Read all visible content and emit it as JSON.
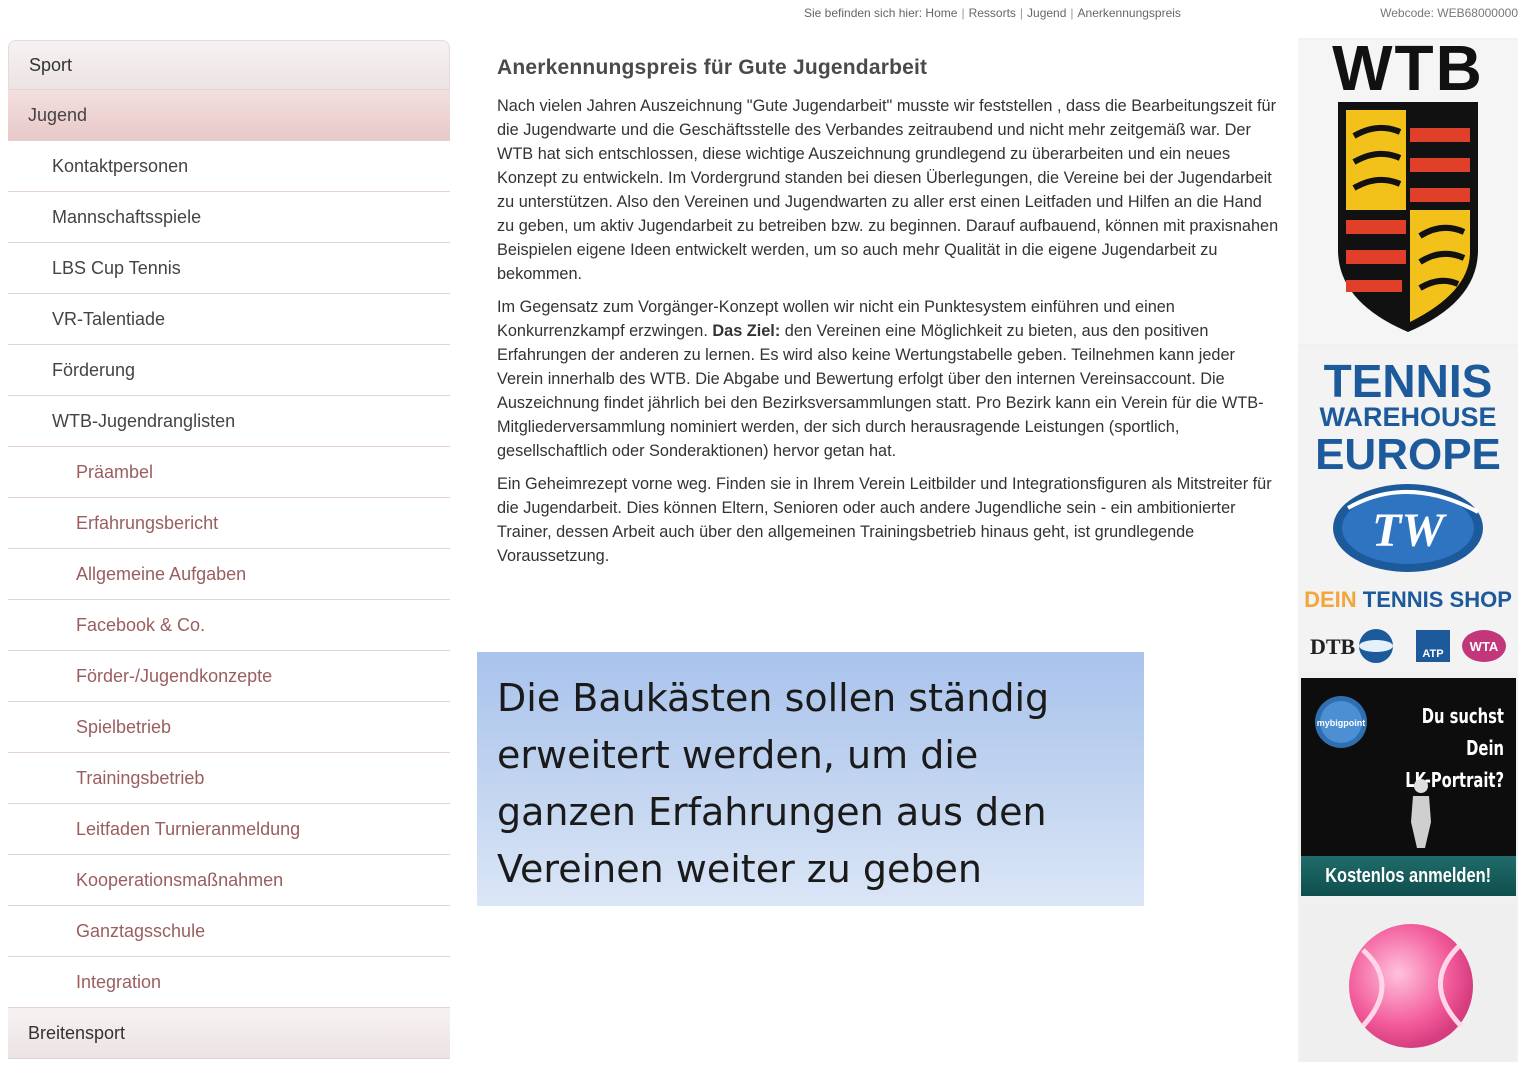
{
  "breadcrumb": {
    "prefix": "Sie befinden sich hier:",
    "items": [
      "Home",
      "Ressorts",
      "Jugend",
      "Anerkennungspreis"
    ]
  },
  "webcode": "Webcode: WEB68000000",
  "sidebar": {
    "items": [
      {
        "label": "Sport",
        "level": 0
      },
      {
        "label": "Jugend",
        "level": 0,
        "active": true
      },
      {
        "label": "Kontaktpersonen",
        "level": 1
      },
      {
        "label": "Mannschaftsspiele",
        "level": 1
      },
      {
        "label": "LBS Cup Tennis",
        "level": 1
      },
      {
        "label": "VR-Talentiade",
        "level": 1
      },
      {
        "label": "Förderung",
        "level": 1
      },
      {
        "label": "WTB-Jugendranglisten",
        "level": 1
      },
      {
        "label": "Präambel",
        "level": 2
      },
      {
        "label": "Erfahrungsbericht",
        "level": 2
      },
      {
        "label": "Allgemeine Aufgaben",
        "level": 2
      },
      {
        "label": "Facebook & Co.",
        "level": 2
      },
      {
        "label": "Förder-/Jugendkonzepte",
        "level": 2
      },
      {
        "label": "Spielbetrieb",
        "level": 2
      },
      {
        "label": "Trainingsbetrieb",
        "level": 2
      },
      {
        "label": "Leitfaden Turnieranmeldung",
        "level": 2
      },
      {
        "label": "Kooperationsmaßnahmen",
        "level": 2
      },
      {
        "label": "Ganztagsschule",
        "level": 2
      },
      {
        "label": "Integration",
        "level": 2
      },
      {
        "label": "Breitensport",
        "level": 0
      }
    ]
  },
  "article": {
    "title": "Anerkennungspreis für Gute Jugendarbeit",
    "p1": "Nach vielen Jahren Auszeichnung \"Gute Jugendarbeit\" musste wir feststellen , dass die Bearbeitungszeit für die Jugendwarte und die Geschäftsstelle des Verbandes zeitraubend und nicht mehr zeitgemäß war. Der WTB hat sich entschlossen, diese wichtige Auszeichnung grundlegend zu überarbeiten und ein neues Konzept zu entwickeln. Im Vordergrund standen bei diesen Überlegungen, die Vereine bei der Jugendarbeit zu unterstützen. Also den Vereinen und Jugendwarten zu aller erst einen Leitfaden und Hilfen an die Hand zu geben, um aktiv Jugendarbeit zu betreiben bzw. zu beginnen. Darauf aufbauend, können mit praxisnahen Beispielen eigene Ideen entwickelt werden, um so auch mehr Qualität in die eigene Jugendarbeit zu bekommen.",
    "p2_pre": "Im Gegensatz zum Vorgänger-Konzept wollen wir nicht ein Punktesystem einführen und einen Konkurrenzkampf erzwingen.",
    "p2_bold": "Das Ziel:",
    "p2_post": "den Vereinen eine Möglichkeit zu bieten, aus den positiven Erfahrungen der anderen zu lernen. Es wird also keine Wertungstabelle geben. Teilnehmen kann jeder Verein innerhalb des WTB. Die Abgabe und Bewertung erfolgt über den internen Vereinsaccount. Die Auszeichnung findet jährlich bei den Bezirksversammlungen statt. Pro Bezirk kann ein Verein für die WTB-Mitgliederversammlung nominiert werden, der sich durch herausragende Leistungen (sportlich, gesellschaftlich oder Sonderaktionen) hervor getan hat.",
    "p3": "Ein Geheimrezept vorne weg. Finden sie in Ihrem Verein Leitbilder und Integrationsfiguren als Mitstreiter für die Jugendarbeit. Dies können Eltern, Senioren oder auch andere Jugendliche sein - ein ambitionierter Trainer, dessen Arbeit auch über den allgemeinen Trainingsbetrieb hinaus geht, ist grundlegende Voraussetzung."
  },
  "callout": {
    "text": "Die Baukästen sollen ständig erweitert werden, um die ganzen Erfahrungen aus den Vereinen weiter zu geben"
  },
  "ads": {
    "wtb": {
      "logo_text": "WTB",
      "colors": {
        "black": "#111111",
        "red": "#e0402a",
        "yellow": "#f2c21b"
      }
    },
    "tennis_warehouse": {
      "line1": "TENNIS",
      "line2": "WAREHOUSE",
      "line3": "EUROPE",
      "emblem": "TW",
      "shop_dein": "DEIN",
      "shop_rest": "TENNIS SHOP",
      "partners": [
        "DTB",
        "mybigpoint",
        "ATP",
        "WTA"
      ]
    },
    "lk": {
      "badge": "mybigpoint",
      "title_line1": "Du suchst Dein",
      "title_line2": "LK-Portrait?",
      "footer": "Kostenlos anmelden!"
    },
    "ball": {
      "icon": "tennis-ball-icon",
      "color": "#f25a9a"
    }
  }
}
